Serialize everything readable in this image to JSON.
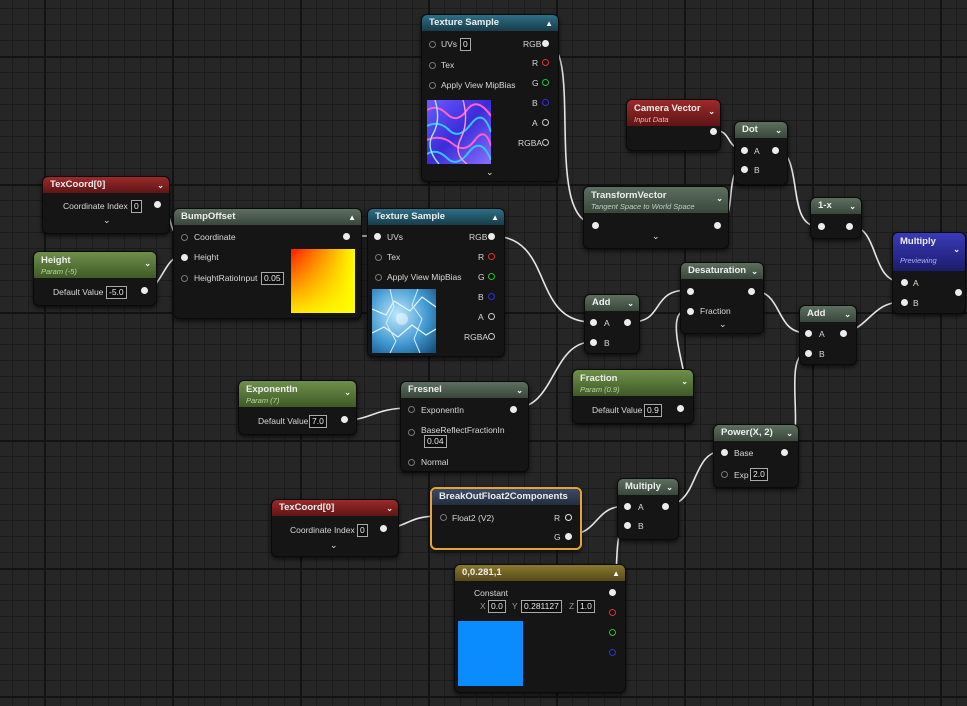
{
  "nodes": {
    "texsample_top": {
      "title": "Texture Sample",
      "uvs": "UVs",
      "uv_value": "0",
      "tex": "Tex",
      "mip": "Apply View MipBias",
      "rgb": "RGB",
      "r": "R",
      "g": "G",
      "b": "B",
      "a": "A",
      "rgba": "RGBA"
    },
    "camera_vector": {
      "title": "Camera Vector",
      "subtitle": "Input Data"
    },
    "dot": {
      "title": "Dot",
      "a": "A",
      "b": "B"
    },
    "transform_vector": {
      "title": "TransformVector",
      "subtitle": "Tangent Space to World Space"
    },
    "one_minus_x": {
      "title": "1-x"
    },
    "multiply_main": {
      "title": "Multiply",
      "subtitle": "Previewing",
      "a": "A",
      "b": "B"
    },
    "texcoord_top": {
      "title": "TexCoord[0]",
      "label": "Coordinate Index",
      "value": "0"
    },
    "bump_offset": {
      "title": "BumpOffset",
      "coordinate": "Coordinate",
      "height": "Height",
      "ratio": "HeightRatioInput",
      "ratio_value": "0.05"
    },
    "texsample_mid": {
      "title": "Texture Sample",
      "uvs": "UVs",
      "tex": "Tex",
      "mip": "Apply View MipBias",
      "rgb": "RGB",
      "r": "R",
      "g": "G",
      "b": "B",
      "a": "A",
      "rgba": "RGBA"
    },
    "height_param": {
      "title": "Height",
      "subtitle": "Param (-5)",
      "label": "Default Value",
      "value": "-5.0"
    },
    "desaturation": {
      "title": "Desaturation",
      "fraction": "Fraction"
    },
    "add_left": {
      "title": "Add",
      "a": "A",
      "b": "B"
    },
    "add_right": {
      "title": "Add",
      "a": "A",
      "b": "B"
    },
    "fraction_param": {
      "title": "Fraction",
      "subtitle": "Param (0.9)",
      "label": "Default Value",
      "value": "0.9"
    },
    "exponent_param": {
      "title": "ExponentIn",
      "subtitle": "Param (7)",
      "label": "Default Value",
      "value": "7.0"
    },
    "fresnel": {
      "title": "Fresnel",
      "exponent": "ExponentIn",
      "base": "BaseReflectFractionIn",
      "base_value": "0.04",
      "normal": "Normal"
    },
    "power": {
      "title": "Power(X, 2)",
      "base": "Base",
      "exp": "Exp",
      "exp_value": "2.0"
    },
    "texcoord_bottom": {
      "title": "TexCoord[0]",
      "label": "Coordinate Index",
      "value": "0"
    },
    "breakout": {
      "title": "BreakOutFloat2Components",
      "input": "Float2 (V2)",
      "r": "R",
      "g": "G"
    },
    "multiply_bottom": {
      "title": "Multiply",
      "a": "A",
      "b": "B"
    },
    "constant": {
      "title": "0,0.281,1",
      "label": "Constant",
      "x_label": "X",
      "x_value": "0.0",
      "y_label": "Y",
      "y_value": "0.281127",
      "z_label": "Z",
      "z_value": "1.0",
      "swatch_color": "#0a8cff"
    }
  },
  "colors": {
    "selected_outline": "#e6a532",
    "wire": "#e6e6e6"
  }
}
